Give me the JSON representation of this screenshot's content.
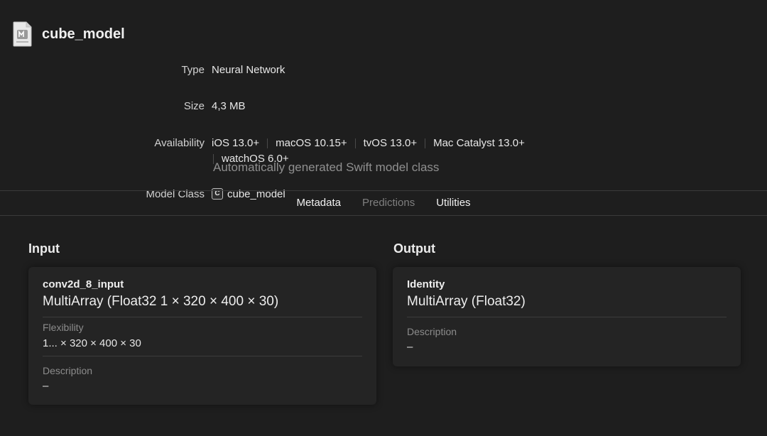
{
  "header": {
    "title": "cube_model",
    "icon": "mlmodel-file-icon"
  },
  "info": {
    "type_label": "Type",
    "type_value": "Neural Network",
    "size_label": "Size",
    "size_value": "4,3 MB",
    "availability_label": "Availability",
    "availability": [
      "iOS 13.0+",
      "macOS 10.15+",
      "tvOS 13.0+",
      "Mac Catalyst 13.0+",
      "watchOS 6.0+"
    ],
    "model_class_label": "Model Class",
    "model_class_badge": "C",
    "model_class_value": "cube_model",
    "model_class_description": "Automatically generated Swift model class"
  },
  "tabs": [
    {
      "label": "Metadata",
      "state": "normal"
    },
    {
      "label": "Predictions",
      "state": "dimmed"
    },
    {
      "label": "Utilities",
      "state": "normal"
    }
  ],
  "input": {
    "section_title": "Input",
    "name": "conv2d_8_input",
    "type": "MultiArray (Float32 1 × 320 × 400 × 30)",
    "flexibility_label": "Flexibility",
    "flexibility_value": "1... × 320 × 400 × 30",
    "description_label": "Description",
    "description_value": "–"
  },
  "output": {
    "section_title": "Output",
    "name": "Identity",
    "type": "MultiArray (Float32)",
    "description_label": "Description",
    "description_value": "–"
  },
  "colors": {
    "background": "#1e1e1e",
    "card": "#242424",
    "text": "#e6e6e6",
    "dim_text": "#8c8c8c"
  }
}
